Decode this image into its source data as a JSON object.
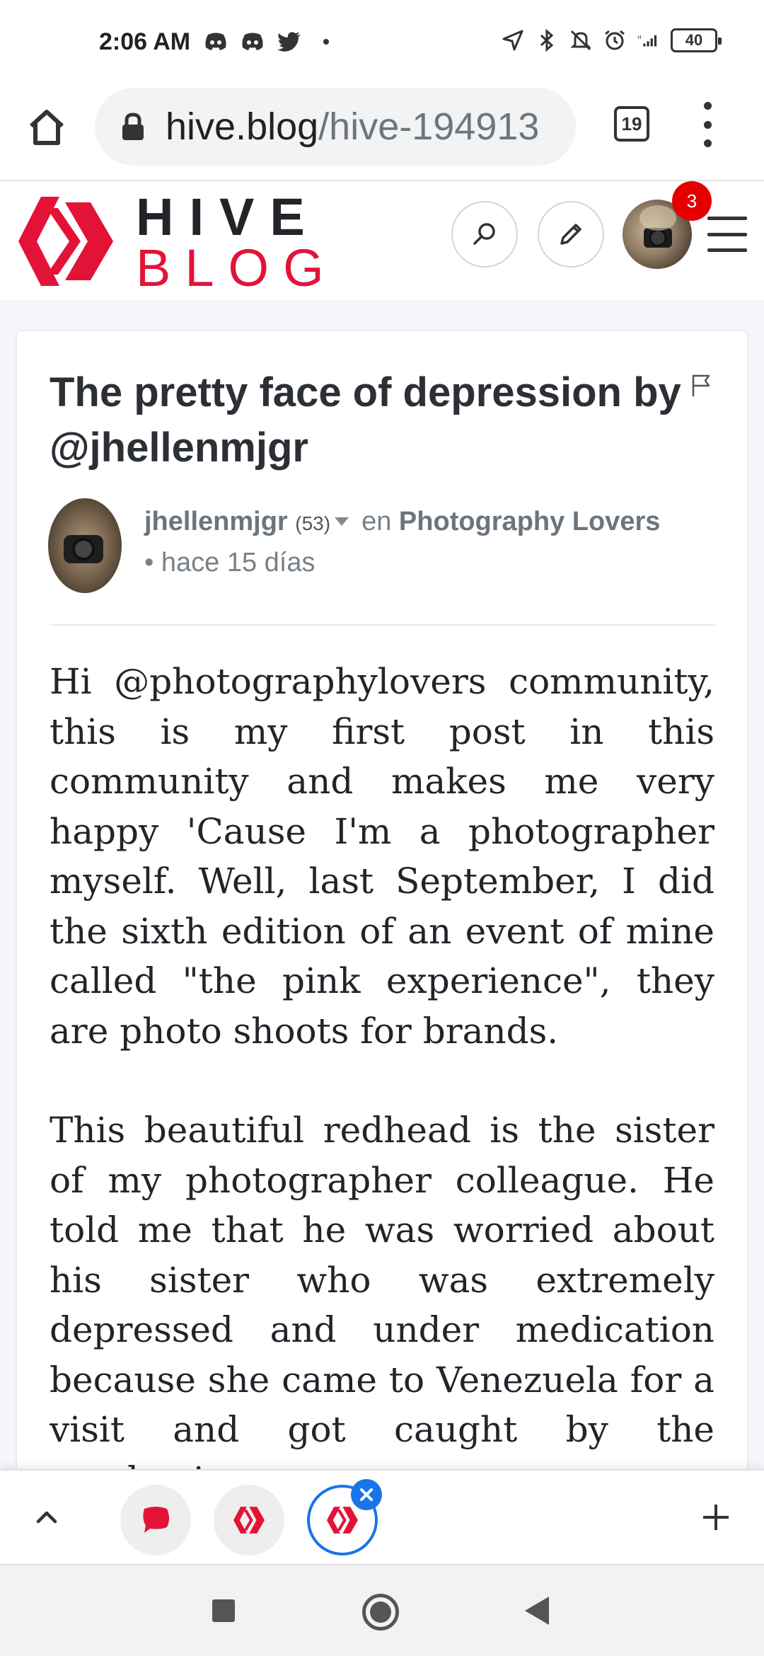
{
  "status_bar": {
    "time": "2:06 AM",
    "left_icons": [
      "discord-icon",
      "discord-icon",
      "twitter-icon",
      "dot-icon"
    ],
    "right_icons": [
      "location-icon",
      "bluetooth-icon",
      "mute-icon",
      "alarm-icon",
      "signal-icon"
    ],
    "battery": "40"
  },
  "browser": {
    "url_host": "hive.blog",
    "url_path": "/hive-194913",
    "tab_count": "19"
  },
  "site_header": {
    "logo_top": "HIVE",
    "logo_bottom": "BLOG",
    "notification_count": "3",
    "brand_color": "#e31337"
  },
  "post": {
    "title": "The pretty face of depression by @jhellenmjgr",
    "author": "jhellenmjgr",
    "reputation": "(53)",
    "in_label": "en",
    "community": "Photography Lovers",
    "time": "• hace 15 días",
    "paragraphs": [
      "Hi @photographylovers community, this is my first post in this community and makes me very happy 'Cause I'm a photographer myself. Well, last September, I did the sixth edition of an event of mine called \"the pink experience\", they are photo shoots for brands.",
      "This beautiful redhead is the sister of my photographer colleague. He told me that he was worried about his sister who was extremely depressed and under medication because she came to Venezuela for a visit and got caught by the pandemic"
    ]
  },
  "tab_strip": {
    "tabs": [
      "tab-discord",
      "tab-hive",
      "tab-hive-active"
    ]
  }
}
